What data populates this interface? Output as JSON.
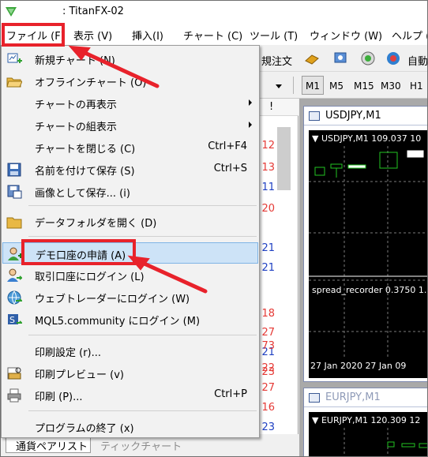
{
  "window": {
    "title": ": TitanFX-02"
  },
  "menubar": [
    "ファイル (F)",
    "表示 (V)",
    "挿入(I)",
    "チャート (C)",
    "ツール (T)",
    "ウィンドウ (W)",
    "ヘルプ ("
  ],
  "toolbar": {
    "order_label": "規注文",
    "auto_label": "自動"
  },
  "timeframes": [
    "M1",
    "M5",
    "M15",
    "M30",
    "H1"
  ],
  "file_menu": [
    {
      "label": "新規チャート (N)",
      "shortcut": "",
      "icon": "new-chart-icon"
    },
    {
      "label": "オフラインチャート (O)",
      "shortcut": "",
      "icon": "open-folder-icon"
    },
    {
      "label": "チャートの再表示",
      "shortcut": "",
      "submenu": true
    },
    {
      "label": "チャートの組表示",
      "shortcut": "",
      "submenu": true
    },
    {
      "label": "チャートを閉じる (C)",
      "shortcut": "Ctrl+F4"
    },
    {
      "label": "名前を付けて保存 (S)",
      "shortcut": "Ctrl+S",
      "icon": "save-icon"
    },
    {
      "label": "画像として保存... (i)",
      "shortcut": "",
      "icon": "save-image-icon"
    },
    {
      "label": "データフォルダを開く (D)",
      "shortcut": "",
      "icon": "folder-icon"
    },
    {
      "label": "デモ口座の申請 (A)",
      "shortcut": "",
      "icon": "demo-account-icon",
      "highlighted": true
    },
    {
      "label": "取引口座にログイン (L)",
      "shortcut": "",
      "icon": "login-icon"
    },
    {
      "label": "ウェブトレーダーにログイン (W)",
      "shortcut": "",
      "icon": "webtrader-icon"
    },
    {
      "label": "MQL5.community にログイン (M)",
      "shortcut": "",
      "icon": "mql5-icon"
    },
    {
      "label": "印刷設定 (r)...",
      "shortcut": ""
    },
    {
      "label": "印刷プレビュー (v)",
      "shortcut": "",
      "icon": "print-preview-icon"
    },
    {
      "label": "印刷 (P)...",
      "shortcut": "Ctrl+P",
      "icon": "printer-icon"
    },
    {
      "label": "プログラムの終了 (x)",
      "shortcut": ""
    }
  ],
  "list_numbers": [
    {
      "text": "12",
      "color": "red"
    },
    {
      "text": "13",
      "color": "red"
    },
    {
      "text": "11",
      "color": "blue"
    },
    {
      "text": "20",
      "color": "red"
    },
    {
      "text": "21",
      "color": "blue"
    },
    {
      "text": "21",
      "color": "blue"
    },
    {
      "text": "18",
      "color": "red"
    },
    {
      "text": "27",
      "color": "red"
    },
    {
      "text": "21",
      "color": "blue"
    },
    {
      "text": "23",
      "color": "red"
    },
    {
      "text": "73",
      "color": "red"
    },
    {
      "text": "22",
      "color": "red"
    },
    {
      "text": "27",
      "color": "red"
    },
    {
      "text": "16",
      "color": "red"
    },
    {
      "text": "23",
      "color": "blue"
    }
  ],
  "list_header_mark": "!",
  "bottom_tabs": {
    "pairs": "通貨ペアリスト",
    "tick": "ティックチャート"
  },
  "charts": [
    {
      "caption": "USDJPY,M1",
      "header": "▼ USDJPY,M1  109.037 10",
      "indicator": "spread_recorder 0.3750 1.",
      "dates": "27 Jan 2020    27 Jan 09"
    },
    {
      "caption": "EURJPY,M1",
      "header": "▼ EURJPY,M1  120.309 12"
    }
  ],
  "colors": {
    "annotation_red": "#e8222b",
    "highlight": "#cde3f7"
  }
}
